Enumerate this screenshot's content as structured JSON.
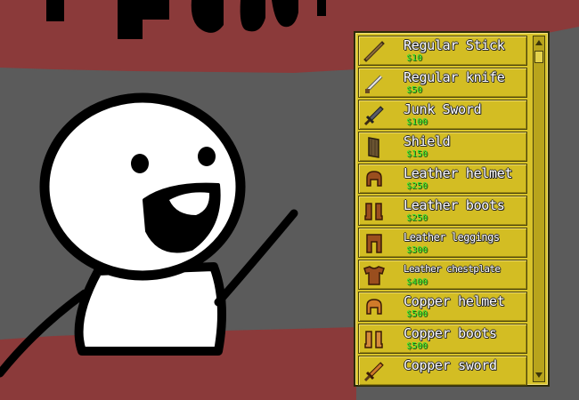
{
  "shop": {
    "items": [
      {
        "name": "Regular Stick",
        "price": "$10",
        "icon": "stick-icon",
        "size": "normal"
      },
      {
        "name": "Regular knife",
        "price": "$50",
        "icon": "knife-icon",
        "size": "normal"
      },
      {
        "name": "Junk Sword",
        "price": "$100",
        "icon": "junk-sword-icon",
        "size": "normal"
      },
      {
        "name": "Shield",
        "price": "$150",
        "icon": "shield-icon",
        "size": "normal"
      },
      {
        "name": "Leather helmet",
        "price": "$250",
        "icon": "leather-helmet-icon",
        "size": "normal"
      },
      {
        "name": "Leather boots",
        "price": "$250",
        "icon": "leather-boots-icon",
        "size": "normal"
      },
      {
        "name": "Leather leggings",
        "price": "$300",
        "icon": "leather-leggings-icon",
        "size": "small"
      },
      {
        "name": "Leather chestplate",
        "price": "$400",
        "icon": "leather-chestplate-icon",
        "size": "tiny"
      },
      {
        "name": "Copper helmet",
        "price": "$500",
        "icon": "copper-helmet-icon",
        "size": "normal"
      },
      {
        "name": "Copper boots",
        "price": "$500",
        "icon": "copper-boots-icon",
        "size": "normal"
      },
      {
        "name": "Copper sword",
        "price": "",
        "icon": "copper-sword-icon",
        "size": "normal"
      }
    ]
  },
  "colors": {
    "panel": "#d8c32a",
    "price": "#2fe32f",
    "item_text": "#ffffff",
    "backdrop_red": "#8b3a3a",
    "backdrop_gray": "#5b5b5b"
  }
}
